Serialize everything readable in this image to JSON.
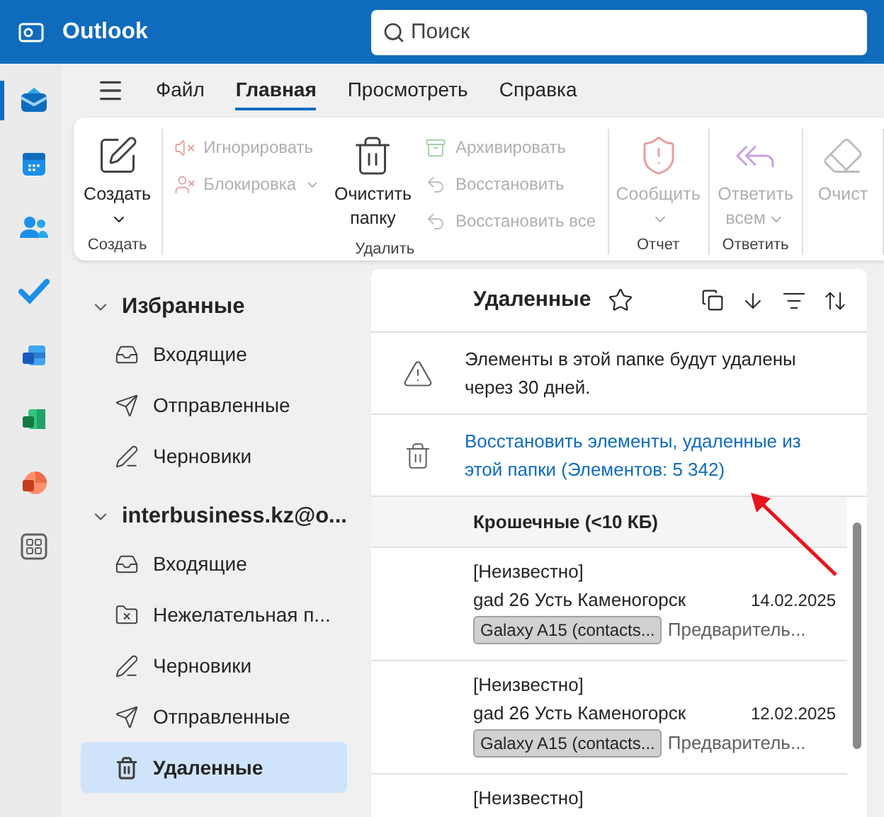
{
  "app": {
    "title": "Outlook"
  },
  "search": {
    "placeholder": "Поиск"
  },
  "rail": [
    {
      "kind": "mail",
      "selected": true
    },
    {
      "kind": "calendar",
      "selected": false
    },
    {
      "kind": "people",
      "selected": false
    },
    {
      "kind": "todo",
      "selected": false
    },
    {
      "kind": "word",
      "selected": false
    },
    {
      "kind": "excel",
      "selected": false
    },
    {
      "kind": "powerpoint",
      "selected": false
    },
    {
      "kind": "apps",
      "selected": false
    }
  ],
  "menu_tabs": [
    {
      "label": "Файл",
      "selected": false
    },
    {
      "label": "Главная",
      "selected": true
    },
    {
      "label": "Просмотреть",
      "selected": false
    },
    {
      "label": "Справка",
      "selected": false
    }
  ],
  "ribbon": {
    "groups": [
      {
        "label": "Создать",
        "columns": [
          [
            {
              "label": "Создать",
              "kind": "large",
              "disabled": false,
              "dropdown": true
            }
          ]
        ]
      },
      {
        "label": "Удалить",
        "columns": [
          [
            {
              "label": "Игнорировать",
              "kind": "small",
              "disabled": true,
              "dropdown": false
            },
            {
              "label": "Блокировка",
              "kind": "small",
              "disabled": true,
              "dropdown": true
            }
          ],
          [
            {
              "label": "Очистить папку",
              "kind": "large",
              "disabled": false,
              "dropdown": false
            }
          ],
          [
            {
              "label": "Архивировать",
              "kind": "small",
              "disabled": true,
              "dropdown": false
            },
            {
              "label": "Восстановить",
              "kind": "small",
              "disabled": true,
              "dropdown": false
            },
            {
              "label": "Восстановить все",
              "kind": "small",
              "disabled": true,
              "dropdown": false
            }
          ]
        ]
      },
      {
        "label": "Отчет",
        "columns": [
          [
            {
              "label": "Сообщить",
              "kind": "large",
              "disabled": true,
              "dropdown": true
            }
          ]
        ]
      },
      {
        "label": "Ответить",
        "columns": [
          [
            {
              "label": "Ответить всем",
              "kind": "large",
              "disabled": true,
              "dropdown": true
            }
          ]
        ]
      },
      {
        "columns": [
          [
            {
              "label": "Очист",
              "kind": "large",
              "disabled": true,
              "dropdown": false
            }
          ]
        ]
      }
    ]
  },
  "folders": [
    {
      "title": "Избранные",
      "expanded": true,
      "items": [
        {
          "label": "Входящие",
          "selected": false
        },
        {
          "label": "Отправленные",
          "selected": false
        },
        {
          "label": "Черновики",
          "selected": false
        }
      ]
    },
    {
      "title": "interbusiness.kz@o...",
      "expanded": true,
      "items": [
        {
          "label": "Входящие",
          "selected": false
        },
        {
          "label": "Нежелательная п...",
          "selected": false
        },
        {
          "label": "Черновики",
          "selected": false
        },
        {
          "label": "Отправленные",
          "selected": false
        },
        {
          "label": "Удаленные",
          "selected": true
        }
      ]
    }
  ],
  "message_list": {
    "title": "Удаленные",
    "notice": "Элементы в этой папке будут удалены через 30 дней.",
    "restore_link": "Восстановить элементы, удаленные из этой папки (Элементов: 5 342)",
    "group_header": "Крошечные (<10 КБ)",
    "messages": [
      {
        "sender": "[Неизвестно]",
        "subject": "gad 26 Усть Каменогорск",
        "date": "14.02.2025",
        "tag": "Galaxy A15 (contacts...",
        "preview": "Предваритель..."
      },
      {
        "sender": "[Неизвестно]",
        "subject": "gad 26 Усть Каменогорск",
        "date": "12.02.2025",
        "tag": "Galaxy A15 (contacts...",
        "preview": "Предваритель..."
      },
      {
        "sender": "[Неизвестно]"
      }
    ]
  }
}
